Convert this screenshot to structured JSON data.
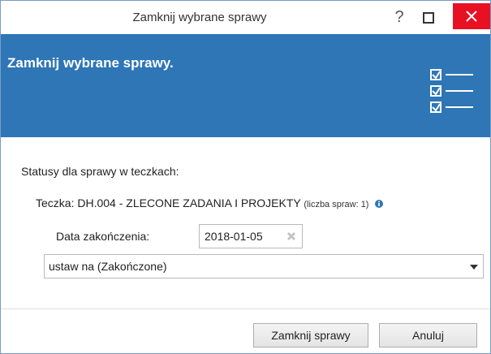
{
  "window": {
    "title": "Zamknij wybrane sprawy",
    "help_glyph": "?",
    "close_color": "#e81123"
  },
  "header": {
    "title": "Zamknij wybrane sprawy.",
    "background": "#2e76b6",
    "icon": "checklist-icon"
  },
  "content": {
    "statuses_label": "Statusy dla sprawy w teczkach:",
    "folder_label": "Teczka: DH.004 - ZLECONE ZADANIA I PROJEKTY",
    "folder_count": "(liczba spraw: 1)",
    "info_icon": "info-icon",
    "date_label": "Data zakończenia:",
    "date_value": "2018-01-05",
    "status_select_value": "ustaw na  (Zakończone)"
  },
  "footer": {
    "close_cases_label": "Zamknij sprawy",
    "cancel_label": "Anuluj"
  }
}
